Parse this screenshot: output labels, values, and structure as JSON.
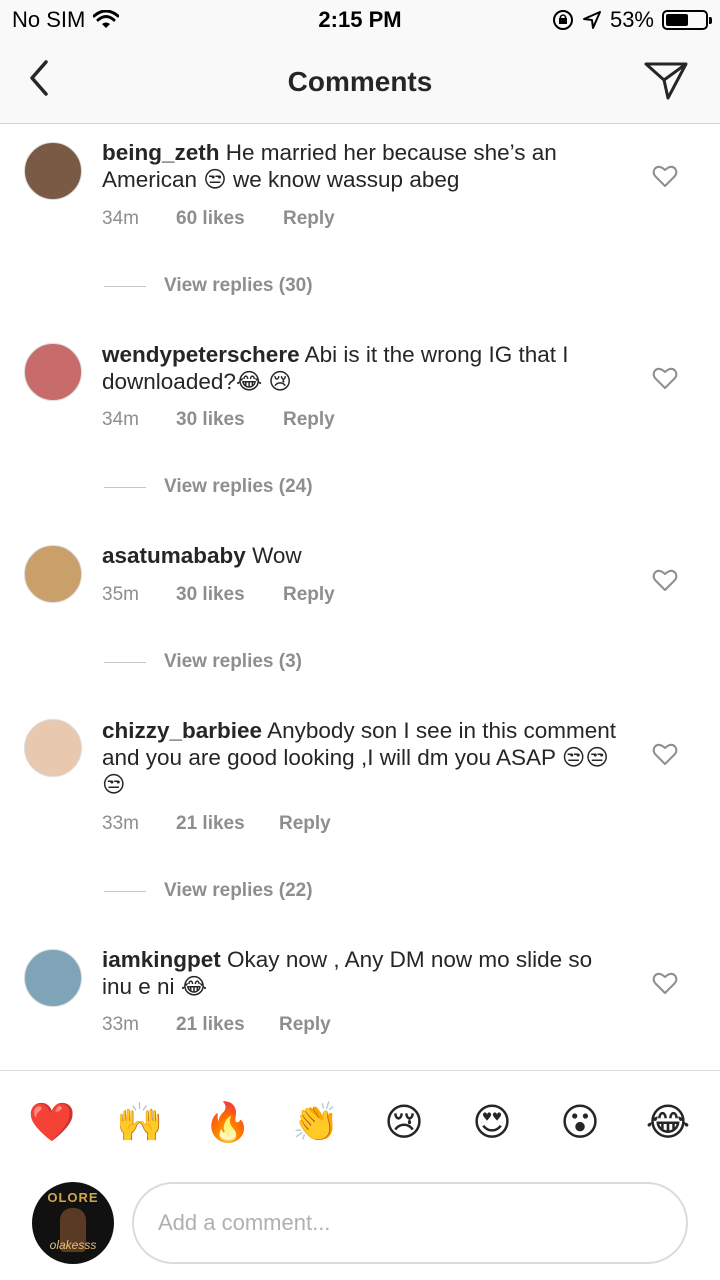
{
  "status": {
    "carrier": "No SIM",
    "time": "2:15 PM",
    "battery": "53%",
    "battery_level": 0.53
  },
  "nav": {
    "title": "Comments"
  },
  "comments": [
    {
      "user": "being_zeth",
      "text": "He married her because she’s an American 😒 we know wassup abeg",
      "time": "34m",
      "likes": "60 likes",
      "reply": "Reply",
      "view_replies": "View replies (30)",
      "avatar_color": "#7a5a45"
    },
    {
      "user": "wendypeterschere",
      "text": "Abi is it the wrong IG that I downloaded?😂 😢",
      "time": "34m",
      "likes": "30 likes",
      "reply": "Reply",
      "view_replies": "View replies (24)",
      "avatar_color": "#c76b6b"
    },
    {
      "user": "asatumababy",
      "text": "Wow",
      "time": "35m",
      "likes": "30 likes",
      "reply": "Reply",
      "view_replies": "View replies (3)",
      "avatar_color": "#c9a06a"
    },
    {
      "user": "chizzy_barbiee",
      "text": "Anybody son I see in this comment and you are good looking ,I will dm you ASAP 😒😒😒",
      "time": "33m",
      "likes": "21 likes",
      "reply": "Reply",
      "view_replies": "View replies (22)",
      "avatar_color": "#e8c9b0"
    },
    {
      "user": "iamkingpet",
      "text": "Okay now , Any DM now mo slide so inu e ni 😂",
      "time": "33m",
      "likes": "21 likes",
      "reply": "Reply",
      "avatar_color": "#7fa4b8"
    }
  ],
  "emoji_bar": [
    "❤️",
    "🙌",
    "🔥",
    "👏",
    "😢",
    "😍",
    "😮",
    "😂"
  ],
  "composer": {
    "placeholder": "Add a comment...",
    "avatar_text_top": "OLORE",
    "avatar_text_bottom": "olakesss"
  }
}
